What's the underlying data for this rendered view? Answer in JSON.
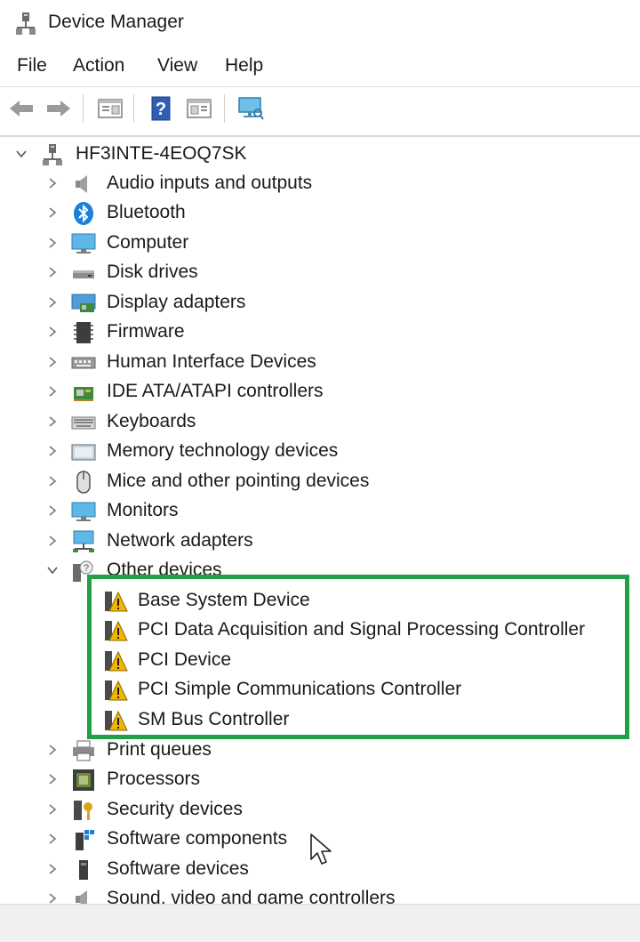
{
  "window": {
    "title": "Device Manager"
  },
  "menu": {
    "file": "File",
    "action": "Action",
    "view": "View",
    "help": "Help"
  },
  "toolbar": {
    "back_icon": "arrow-left-icon",
    "forward_icon": "arrow-right-icon",
    "properties_icon": "properties-icon",
    "help_icon": "help-icon",
    "update_icon": "update-driver-icon",
    "scan_icon": "monitor-scan-icon"
  },
  "tree": {
    "root": "HF3INTE-4EOQ7SK",
    "categories": [
      "Audio inputs and outputs",
      "Bluetooth",
      "Computer",
      "Disk drives",
      "Display adapters",
      "Firmware",
      "Human Interface Devices",
      "IDE ATA/ATAPI controllers",
      "Keyboards",
      "Memory technology devices",
      "Mice and other pointing devices",
      "Monitors",
      "Network adapters",
      "Other devices"
    ],
    "other_devices": [
      "Base System Device",
      "PCI Data Acquisition and Signal Processing Controller",
      "PCI Device",
      "PCI Simple Communications Controller",
      "SM Bus Controller"
    ],
    "more_categories": [
      "Print queues",
      "Processors",
      "Security devices",
      "Software components",
      "Software devices",
      "Sound, video and game controllers"
    ]
  },
  "colors": {
    "highlight": "#22a045",
    "warning": "#f2b500"
  }
}
